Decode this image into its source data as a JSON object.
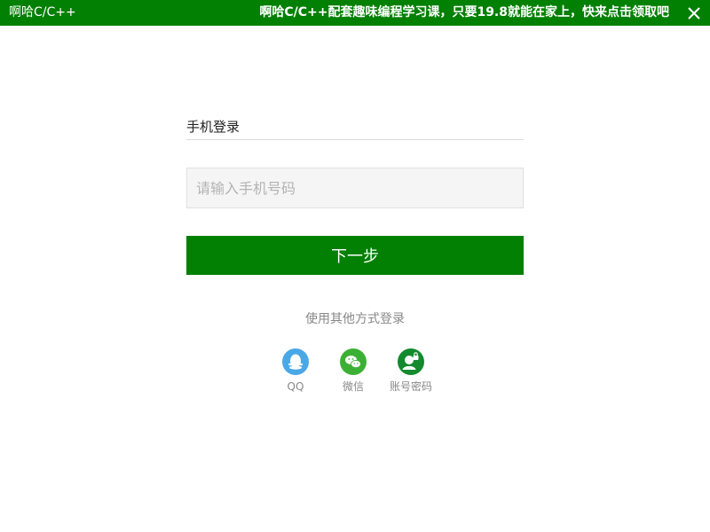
{
  "titlebar": {
    "app_title": "啊哈C/C++",
    "promo_text": "啊哈C/C++配套趣味编程学习课，只要19.8就能在家上，快来点击领取吧",
    "close_icon": "close-icon",
    "background_color": "#028003"
  },
  "login": {
    "heading": "手机登录",
    "phone_input": {
      "placeholder": "请输入手机号码",
      "value": ""
    },
    "next_button_label": "下一步",
    "other_methods_label": "使用其他方式登录",
    "options": [
      {
        "label": "QQ",
        "icon": "qq-icon",
        "color": "#4aa8e6"
      },
      {
        "label": "微信",
        "icon": "wechat-icon",
        "color": "#3cb034"
      },
      {
        "label": "账号密码",
        "icon": "account-password-icon",
        "color": "#138a2e"
      }
    ]
  }
}
